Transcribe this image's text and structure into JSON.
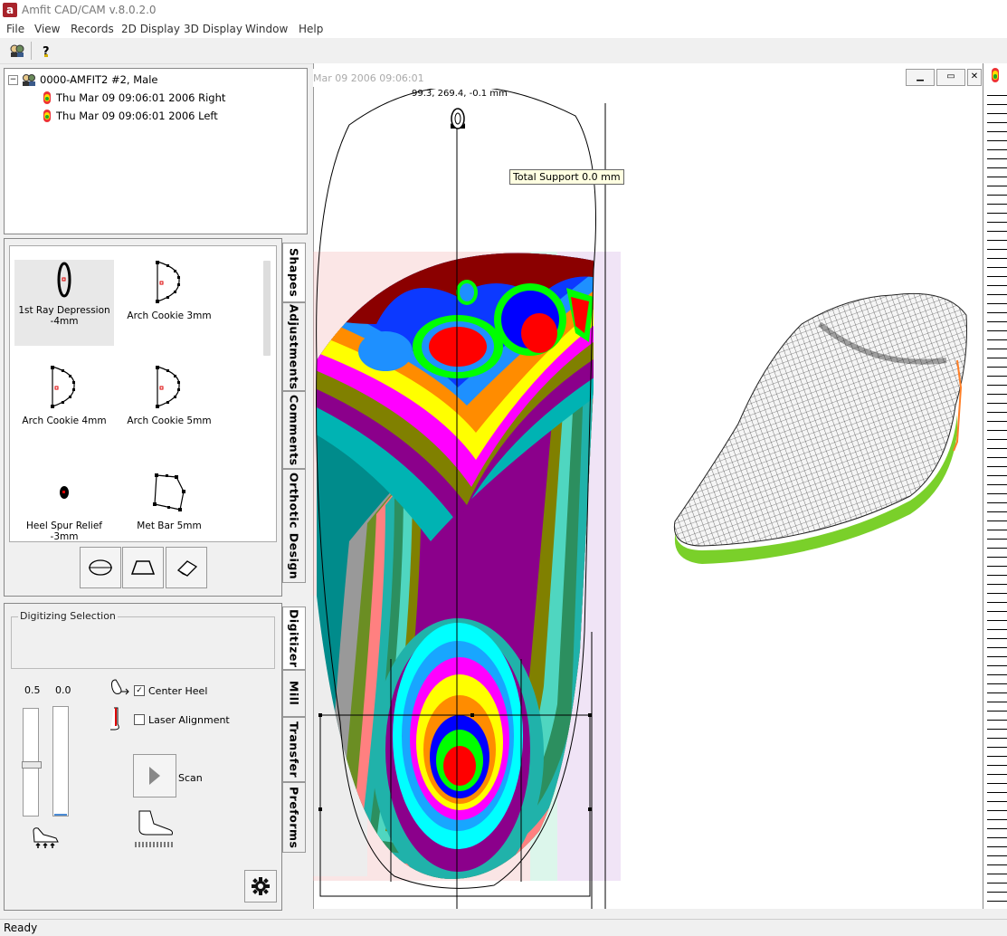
{
  "app": {
    "title": "Amfit CAD/CAM v.8.0.2.0",
    "icon": "app-logo-icon"
  },
  "menu": [
    "File",
    "View",
    "Records",
    "2D Display",
    "3D Display",
    "Window",
    "Help"
  ],
  "toolbar": {
    "icons": [
      "patient-record-icon",
      "help-icon"
    ]
  },
  "tree": {
    "patient": "0000-AMFIT2  #2, Male",
    "records": [
      "Thu Mar 09 09:06:01 2006 Right",
      "Thu Mar 09 09:06:01 2006 Left"
    ]
  },
  "shapes": {
    "items": [
      {
        "label": "1st Ray Depression -4mm",
        "icon": "ellipse-shape-icon",
        "selected": true
      },
      {
        "label": "Arch Cookie 3mm",
        "icon": "arch-cookie-icon"
      },
      {
        "label": "Arch Cookie 4mm",
        "icon": "arch-cookie-icon"
      },
      {
        "label": "Arch Cookie 5mm",
        "icon": "arch-cookie-icon"
      },
      {
        "label": "Heel Spur Relief -3mm",
        "icon": "heel-spur-icon"
      },
      {
        "label": "Met Bar 5mm",
        "icon": "met-bar-icon"
      }
    ],
    "tools": [
      "ellipse-tool-icon",
      "trapezoid-tool-icon",
      "eraser-tool-icon"
    ]
  },
  "tabs_top": [
    "Shapes",
    "Adjustments",
    "Comments",
    "Orthotic Design"
  ],
  "tabs_bottom": [
    "Digitizer",
    "Mill",
    "Transfer",
    "Preforms"
  ],
  "digitizer": {
    "group_title": "Digitizing Selection",
    "slider1_value": "0.5",
    "slider2_value": "0.0",
    "center_heel": {
      "label": "Center Heel",
      "checked": true
    },
    "laser_alignment": {
      "label": "Laser Alignment",
      "checked": false
    },
    "scan_label": "Scan",
    "settings_icon": "gear-icon"
  },
  "view": {
    "title": "Mar 09 2006 09:06:01",
    "coords": "99.3, 269.4, -0.1 mm",
    "tooltip": "Total Support 0.0 mm"
  },
  "status": "Ready"
}
